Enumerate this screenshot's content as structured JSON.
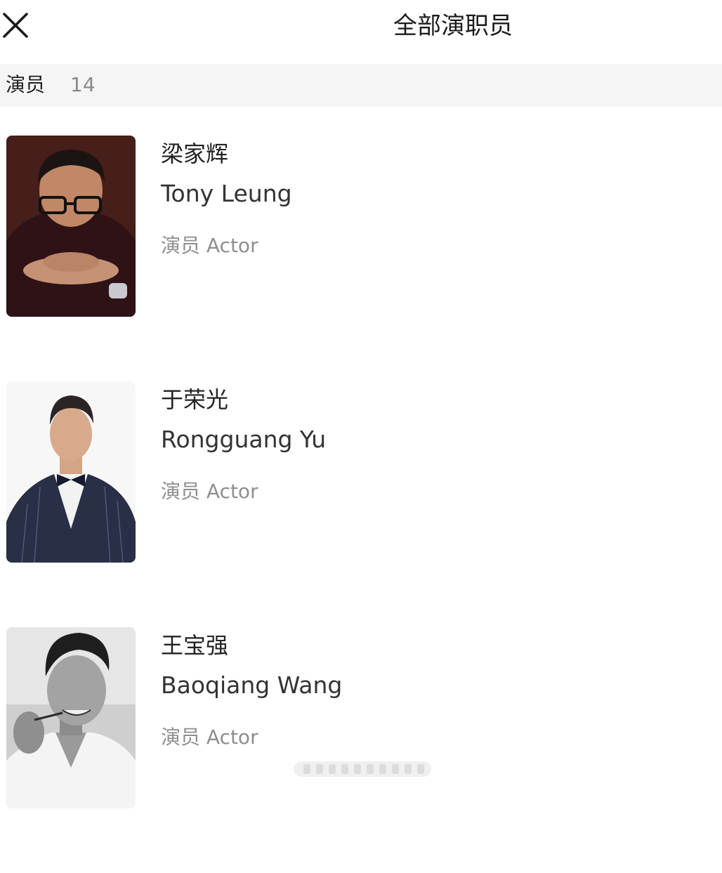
{
  "header": {
    "title": "全部演职员",
    "close_icon": "close-icon"
  },
  "section": {
    "label": "演员",
    "count": "14"
  },
  "cast": [
    {
      "name_cn": "梁家辉",
      "name_en": "Tony Leung",
      "role": "演员 Actor",
      "photo": "portrait-photo"
    },
    {
      "name_cn": "于荣光",
      "name_en": "Rongguang Yu",
      "role": "演员 Actor",
      "photo": "portrait-photo"
    },
    {
      "name_cn": "王宝强",
      "name_en": "Baoqiang Wang",
      "role": "演员 Actor",
      "photo": "portrait-photo"
    }
  ],
  "colors": {
    "background": "#ffffff",
    "section_bar": "#f5f5f5",
    "muted_text": "#8e8e8e"
  }
}
